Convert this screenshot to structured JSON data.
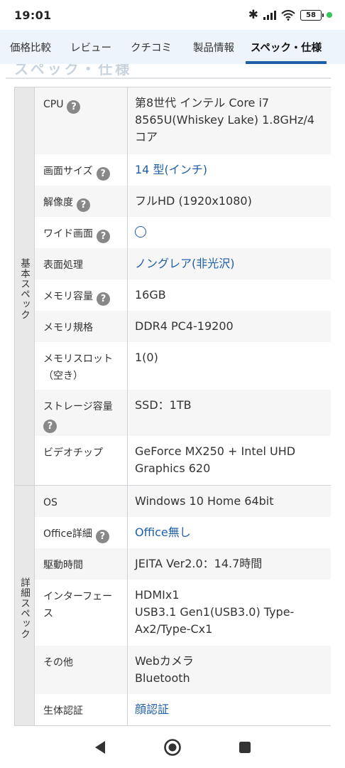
{
  "status_bar": {
    "time": "19:01",
    "battery": "58",
    "icons": [
      "bluetooth-icon",
      "signal-icon",
      "wifi-icon",
      "battery-icon",
      "notification-dot-icon"
    ]
  },
  "tabs": [
    {
      "label": "価格比較",
      "active": false
    },
    {
      "label": "レビュー",
      "active": false
    },
    {
      "label": "クチコミ",
      "active": false
    },
    {
      "label": "製品情報",
      "active": false
    },
    {
      "label": "スペック・仕様",
      "active": true
    }
  ],
  "section_heading_faded": "スペック・仕様",
  "groups": [
    {
      "label": "基本スペック",
      "rows": [
        {
          "label": "CPU",
          "help": true,
          "value": "第8世代 インテル Core i7 8565U(Whiskey Lake) 1.8GHz/4コア",
          "link": false
        },
        {
          "label": "画面サイズ",
          "help": true,
          "value": "14 型(インチ)",
          "link": true
        },
        {
          "label": "解像度",
          "help": true,
          "value": "フルHD (1920x1080)",
          "link": false
        },
        {
          "label": "ワイド画面",
          "help": true,
          "value": "",
          "mark": "circle",
          "link": false
        },
        {
          "label": "表面処理",
          "help": false,
          "value": "ノングレア(非光沢)",
          "link": true
        },
        {
          "label": "メモリ容量",
          "help": true,
          "value": "16GB",
          "link": false
        },
        {
          "label": "メモリ規格",
          "help": false,
          "value": "DDR4 PC4-19200",
          "link": false
        },
        {
          "label": "メモリスロット（空き）",
          "help": false,
          "value": "1(0)",
          "link": false
        },
        {
          "label": "ストレージ容量",
          "help": true,
          "value": "SSD：1TB",
          "link": false
        },
        {
          "label": "ビデオチップ",
          "help": false,
          "value": "GeForce MX250 + Intel UHD Graphics 620",
          "link": false
        }
      ]
    },
    {
      "label": "詳細スペック",
      "rows": [
        {
          "label": "OS",
          "help": false,
          "value": "Windows 10 Home 64bit",
          "link": false
        },
        {
          "label": "Office詳細",
          "help": true,
          "value": "Office無し",
          "link": true
        },
        {
          "label": "駆動時間",
          "help": false,
          "value": "JEITA Ver2.0：14.7時間",
          "link": false
        },
        {
          "label": "インターフェース",
          "help": false,
          "value": "HDMIx1\nUSB3.1 Gen1(USB3.0) Type-Ax2/Type-Cx1",
          "link": false
        },
        {
          "label": "その他",
          "help": false,
          "value": "Webカメラ\nBluetooth",
          "link": false
        },
        {
          "label": "生体認証",
          "help": false,
          "value": "顔認証",
          "link": true
        }
      ]
    }
  ],
  "nav_bar": {
    "buttons": [
      "back-icon",
      "home-icon",
      "recents-icon"
    ]
  }
}
